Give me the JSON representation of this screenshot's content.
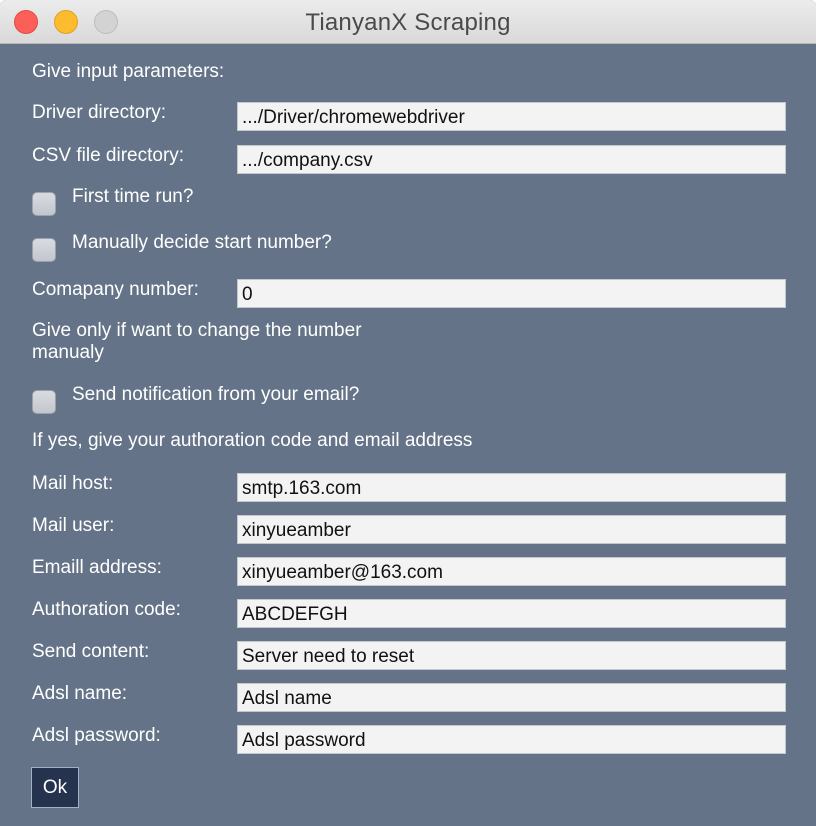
{
  "window": {
    "title": "TianyanX Scraping"
  },
  "form": {
    "intro": "Give input parameters:",
    "driver_label": "Driver directory:",
    "driver_value": ".../Driver/chromewebdriver",
    "csv_label": "CSV file directory:",
    "csv_value": ".../company.csv",
    "first_run_label": "First time run?",
    "first_run_checked": false,
    "manual_start_label": "Manually decide start number?",
    "manual_start_checked": false,
    "company_number_label": "Comapany number:",
    "company_number_value": "0",
    "company_number_hint": "Give only if want to change the number manualy",
    "notify_label": "Send notification from your email?",
    "notify_checked": false,
    "notify_hint": "If yes, give your authoration code and email address",
    "mail_host_label": "Mail host:",
    "mail_host_value": "smtp.163.com",
    "mail_user_label": "Mail user:",
    "mail_user_value": "xinyueamber",
    "email_label": "Emaill address:",
    "email_value": "xinyueamber@163.com",
    "auth_code_label": "Authoration code:",
    "auth_code_value": "ABCDEFGH",
    "send_content_label": "Send content:",
    "send_content_value": "Server need to reset",
    "adsl_name_label": "Adsl name:",
    "adsl_name_value": "Adsl name",
    "adsl_password_label": "Adsl password:",
    "adsl_password_value": "Adsl password",
    "ok_label": "Ok"
  },
  "colors": {
    "window_bg": "#647387",
    "ok_button_bg": "#26334f",
    "field_bg": "#f3f3f3"
  }
}
